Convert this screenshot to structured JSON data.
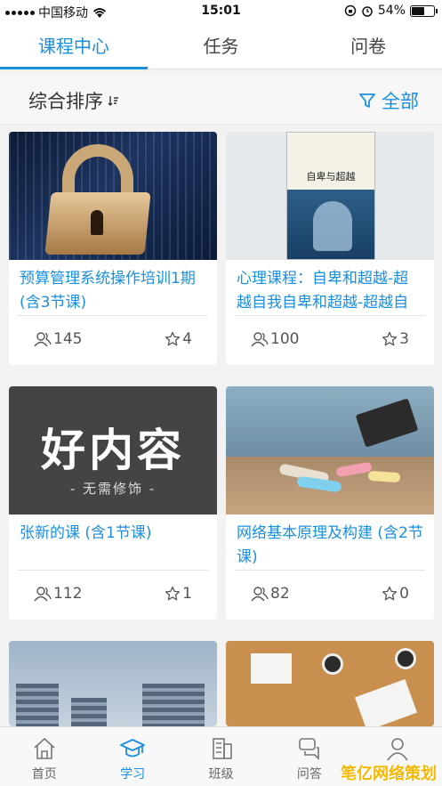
{
  "status_bar": {
    "carrier": "中国移动",
    "time": "15:01",
    "battery": "54%"
  },
  "tabs": [
    {
      "label": "课程中心",
      "active": true
    },
    {
      "label": "任务",
      "active": false
    },
    {
      "label": "问卷",
      "active": false
    }
  ],
  "sort": {
    "label": "综合排序",
    "filter_label": "全部"
  },
  "courses": [
    {
      "title": "预算管理系统操作培训1期 (含3节课)",
      "learners": "145",
      "stars": "4",
      "thumb": "lock"
    },
    {
      "title": "心理课程：自卑和超越-超越自我自卑和超越-超越自",
      "learners": "100",
      "stars": "3",
      "thumb": "book",
      "book_title": "自卑与超越"
    },
    {
      "title": "张新的课 (含1节课)",
      "learners": "112",
      "stars": "1",
      "thumb": "dark",
      "big_text": "好内容",
      "small_text": "- 无需修饰 -"
    },
    {
      "title": "网络基本原理及构建 (含2节课)",
      "learners": "82",
      "stars": "0",
      "thumb": "chalk"
    },
    {
      "title": "",
      "learners": "",
      "stars": "",
      "thumb": "buildings"
    },
    {
      "title": "",
      "learners": "",
      "stars": "",
      "thumb": "desk"
    }
  ],
  "bottom_nav": [
    {
      "label": "首页",
      "icon": "home-icon",
      "active": false
    },
    {
      "label": "学习",
      "icon": "graduation-cap-icon",
      "active": true
    },
    {
      "label": "班级",
      "icon": "building-icon",
      "active": false
    },
    {
      "label": "问答",
      "icon": "chat-bubbles-icon",
      "active": false
    },
    {
      "label": "我",
      "icon": "person-icon",
      "active": false
    }
  ],
  "colors": {
    "accent": "#1a8fe0",
    "watermark": "#f5b700"
  },
  "watermark": "笔亿网络策划"
}
